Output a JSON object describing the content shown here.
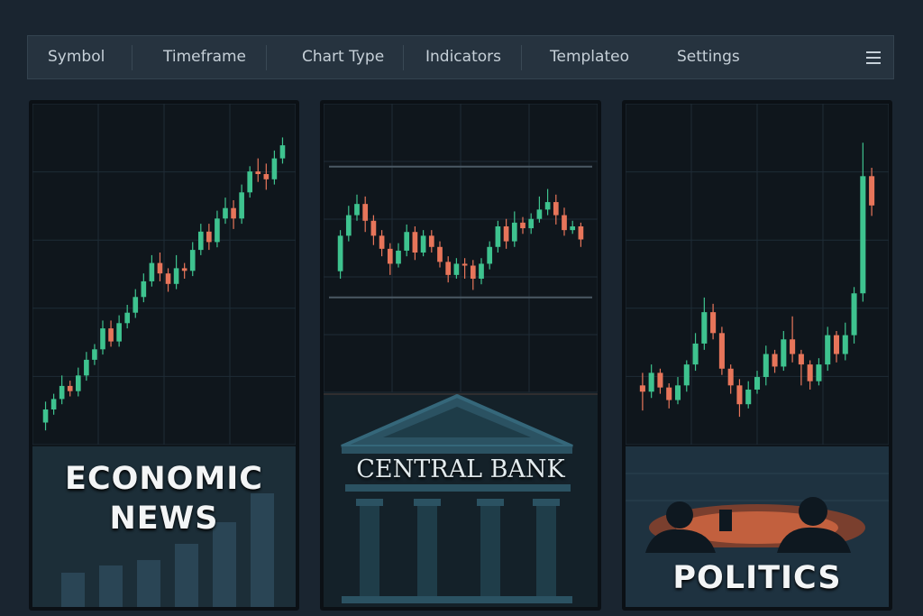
{
  "toolbar": {
    "items": [
      "Symbol",
      "Timeframe",
      "Chart Type",
      "Indicators",
      "Templateo",
      "Settings"
    ],
    "menu_icon": "hamburger-menu-icon"
  },
  "colors": {
    "background": "#1a2530",
    "toolbar": "#26333f",
    "panel": "#0f161c",
    "bull": "#3ec38f",
    "bear": "#e7755a",
    "grid": "#1f2c36"
  },
  "panels": [
    {
      "caption_lines": [
        "ECONOMIC",
        "NEWS"
      ],
      "chart_data": {
        "type": "candlestick",
        "trend": "uptrend",
        "candles": [
          [
            0.5,
            1.0,
            0.2,
            1.3
          ],
          [
            1.0,
            1.4,
            0.8,
            1.6
          ],
          [
            1.4,
            1.9,
            1.2,
            2.3
          ],
          [
            1.9,
            1.7,
            1.5,
            2.1
          ],
          [
            1.7,
            2.3,
            1.5,
            2.6
          ],
          [
            2.3,
            2.9,
            2.1,
            3.2
          ],
          [
            2.9,
            3.3,
            2.7,
            3.5
          ],
          [
            3.3,
            4.1,
            3.1,
            4.4
          ],
          [
            4.1,
            3.6,
            3.4,
            4.4
          ],
          [
            3.6,
            4.3,
            3.4,
            4.6
          ],
          [
            4.3,
            4.7,
            4.1,
            5.0
          ],
          [
            4.7,
            5.3,
            4.5,
            5.6
          ],
          [
            5.3,
            5.9,
            5.1,
            6.2
          ],
          [
            5.9,
            6.6,
            5.7,
            6.9
          ],
          [
            6.6,
            6.2,
            5.9,
            7.0
          ],
          [
            6.2,
            5.8,
            5.5,
            6.4
          ],
          [
            5.8,
            6.4,
            5.6,
            6.9
          ],
          [
            6.4,
            6.3,
            6.0,
            6.6
          ],
          [
            6.3,
            7.1,
            6.1,
            7.4
          ],
          [
            7.1,
            7.8,
            6.9,
            8.1
          ],
          [
            7.8,
            7.4,
            7.1,
            8.1
          ],
          [
            7.4,
            8.3,
            7.2,
            8.6
          ],
          [
            8.3,
            8.7,
            8.1,
            9.1
          ],
          [
            8.7,
            8.3,
            7.9,
            9.0
          ],
          [
            8.3,
            9.3,
            8.1,
            9.6
          ],
          [
            9.3,
            10.1,
            9.1,
            10.3
          ],
          [
            10.1,
            10.0,
            9.7,
            10.6
          ],
          [
            10.0,
            9.8,
            9.4,
            10.4
          ],
          [
            9.8,
            10.6,
            9.6,
            10.9
          ],
          [
            10.6,
            11.1,
            10.4,
            11.4
          ]
        ]
      }
    },
    {
      "caption_lines": [
        "CENTRAL BANK"
      ],
      "chart_data": {
        "type": "candlestick",
        "trend": "range",
        "range_levels": [
          11.6,
          4.6
        ],
        "candles": [
          [
            6.0,
            7.9,
            5.6,
            8.2
          ],
          [
            7.9,
            9.0,
            7.6,
            9.5
          ],
          [
            9.0,
            9.6,
            8.7,
            10.1
          ],
          [
            9.6,
            8.7,
            8.1,
            10.0
          ],
          [
            8.7,
            7.9,
            7.4,
            9.0
          ],
          [
            7.9,
            7.2,
            6.8,
            8.2
          ],
          [
            7.2,
            6.4,
            5.8,
            7.5
          ],
          [
            6.4,
            7.1,
            6.2,
            7.5
          ],
          [
            7.1,
            8.1,
            6.8,
            8.5
          ],
          [
            8.1,
            7.0,
            6.6,
            8.4
          ],
          [
            7.0,
            7.9,
            6.8,
            8.2
          ],
          [
            7.9,
            7.3,
            7.0,
            8.2
          ],
          [
            7.3,
            6.5,
            6.2,
            7.6
          ],
          [
            6.5,
            5.8,
            5.4,
            6.8
          ],
          [
            5.8,
            6.4,
            5.6,
            6.7
          ],
          [
            6.4,
            6.3,
            5.6,
            6.7
          ],
          [
            6.3,
            5.6,
            5.0,
            6.6
          ],
          [
            5.6,
            6.4,
            5.3,
            6.7
          ],
          [
            6.4,
            7.3,
            6.1,
            7.6
          ],
          [
            7.3,
            8.4,
            7.0,
            8.7
          ],
          [
            8.4,
            7.6,
            7.2,
            8.8
          ],
          [
            7.6,
            8.6,
            7.3,
            9.2
          ],
          [
            8.6,
            8.3,
            8.0,
            8.9
          ],
          [
            8.3,
            8.8,
            8.0,
            9.1
          ],
          [
            8.8,
            9.3,
            8.6,
            10.0
          ],
          [
            9.3,
            9.7,
            9.0,
            10.4
          ],
          [
            9.7,
            9.0,
            8.5,
            10.1
          ],
          [
            9.0,
            8.2,
            7.9,
            9.4
          ],
          [
            8.2,
            8.4,
            8.0,
            8.7
          ],
          [
            8.4,
            7.7,
            7.3,
            8.6
          ]
        ]
      }
    },
    {
      "caption_lines": [
        "POLITICS"
      ],
      "chart_data": {
        "type": "candlestick",
        "trend": "spike",
        "candles": [
          [
            2.4,
            2.1,
            1.2,
            3.0
          ],
          [
            2.1,
            3.0,
            1.8,
            3.4
          ],
          [
            3.0,
            2.3,
            2.0,
            3.2
          ],
          [
            2.3,
            1.7,
            1.3,
            2.5
          ],
          [
            1.7,
            2.4,
            1.5,
            2.8
          ],
          [
            2.4,
            3.4,
            2.1,
            3.6
          ],
          [
            3.4,
            4.4,
            3.1,
            4.9
          ],
          [
            4.4,
            5.9,
            4.1,
            6.6
          ],
          [
            5.9,
            4.9,
            4.6,
            6.3
          ],
          [
            4.9,
            3.2,
            2.9,
            5.2
          ],
          [
            3.2,
            2.4,
            2.0,
            3.4
          ],
          [
            2.4,
            1.5,
            0.9,
            2.7
          ],
          [
            1.5,
            2.2,
            1.3,
            2.6
          ],
          [
            2.2,
            2.8,
            2.0,
            3.1
          ],
          [
            2.8,
            3.9,
            2.4,
            4.3
          ],
          [
            3.9,
            3.3,
            3.0,
            4.1
          ],
          [
            3.3,
            4.6,
            3.1,
            5.0
          ],
          [
            4.6,
            3.9,
            3.5,
            5.7
          ],
          [
            3.9,
            3.4,
            2.4,
            4.1
          ],
          [
            3.4,
            2.6,
            2.2,
            3.6
          ],
          [
            2.6,
            3.4,
            2.4,
            3.7
          ],
          [
            3.4,
            4.8,
            3.1,
            5.2
          ],
          [
            4.8,
            3.9,
            3.5,
            5.0
          ],
          [
            3.9,
            4.8,
            3.6,
            5.4
          ],
          [
            4.8,
            6.8,
            4.4,
            7.1
          ],
          [
            6.8,
            12.4,
            6.4,
            14.0
          ],
          [
            12.4,
            11.0,
            10.5,
            12.8
          ]
        ]
      }
    }
  ]
}
